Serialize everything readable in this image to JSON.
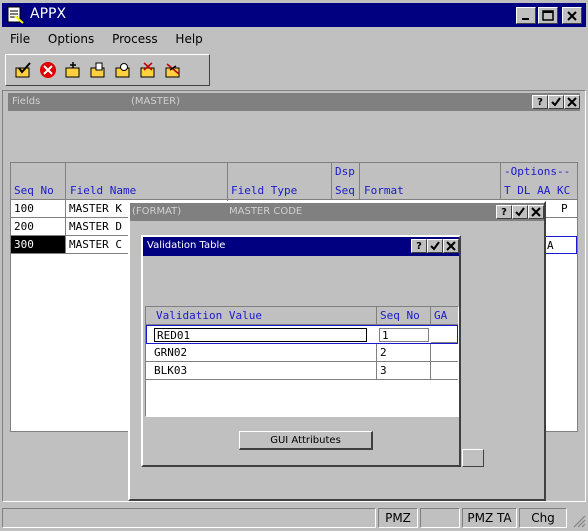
{
  "app": {
    "title": "APPX"
  },
  "menu": {
    "file": "File",
    "options": "Options",
    "process": "Process",
    "help": "Help"
  },
  "fields_window": {
    "title": "Fields",
    "subtitle": "(MASTER)",
    "columns": {
      "seq_no": "Seq No",
      "field_name": "Field Name",
      "field_type": "Field Type",
      "dsp": "Dsp",
      "seq": "Seq",
      "format": "Format",
      "options": "-Options--",
      "opt_codes": "T DL AA KC"
    },
    "rows": [
      {
        "seq": "100",
        "name": "MASTER K",
        "opt": "P"
      },
      {
        "seq": "200",
        "name": "MASTER D",
        "opt": ""
      },
      {
        "seq": "300",
        "name": "MASTER C",
        "opt": "A"
      }
    ]
  },
  "format_window": {
    "title": "(FORMAT)",
    "subtitle": "MASTER CODE"
  },
  "validation_window": {
    "title": "Validation Table",
    "columns": {
      "value": "Validation Value",
      "seq_no": "Seq No",
      "ga": "GA"
    },
    "rows": [
      {
        "value": "RED01",
        "seq": "1"
      },
      {
        "value": "GRN02",
        "seq": "2"
      },
      {
        "value": "BLK03",
        "seq": "3"
      }
    ],
    "gui_button": "GUI Attributes"
  },
  "status_bar": {
    "pmz": "PMZ",
    "pmz_ta": "PMZ TA",
    "chg": "Chg"
  },
  "colors": {
    "titlebar": "#000080",
    "inactive_title": "#808080",
    "face": "#c0c0c0",
    "header_text": "#1a1acc"
  }
}
